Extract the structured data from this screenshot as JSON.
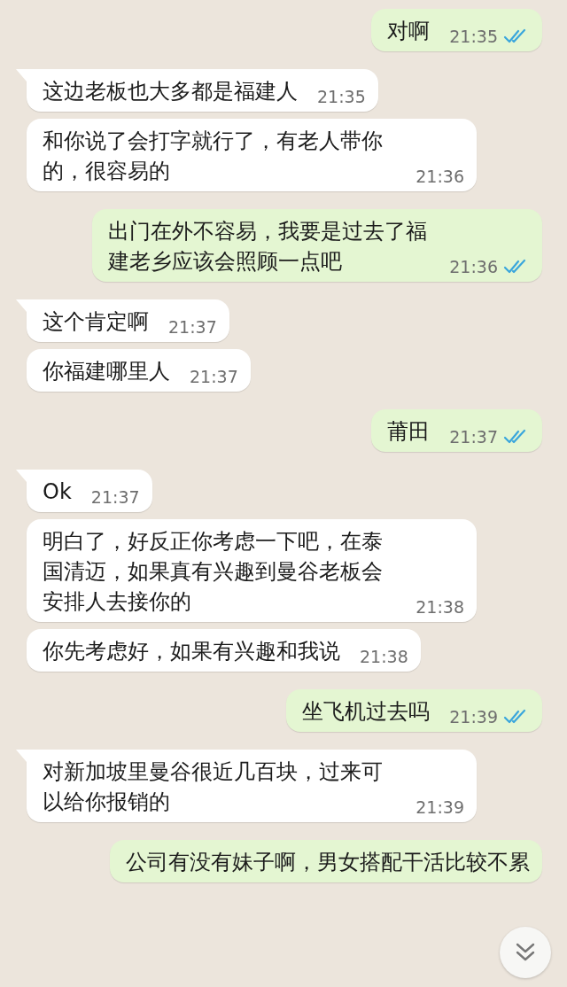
{
  "messages": [
    {
      "kind": "outgoing",
      "text": "对啊",
      "time": "21:35",
      "read": true
    },
    {
      "kind": "incoming",
      "text": "这边老板也大多都是福建人",
      "time": "21:35"
    },
    {
      "kind": "incoming",
      "text": "和你说了会打字就行了，有老人带你的，很容易的",
      "time": "21:36"
    },
    {
      "kind": "outgoing",
      "text": "出门在外不容易，我要是过去了福建老乡应该会照顾一点吧",
      "time": "21:36",
      "read": true
    },
    {
      "kind": "incoming",
      "text": "这个肯定啊",
      "time": "21:37"
    },
    {
      "kind": "incoming",
      "text": "你福建哪里人",
      "time": "21:37"
    },
    {
      "kind": "outgoing",
      "text": "莆田",
      "time": "21:37",
      "read": true
    },
    {
      "kind": "incoming",
      "text": "Ok",
      "time": "21:37"
    },
    {
      "kind": "incoming",
      "text": "明白了，好反正你考虑一下吧，在泰国清迈，如果真有兴趣到曼谷老板会安排人去接你的",
      "time": "21:38"
    },
    {
      "kind": "incoming",
      "text": "你先考虑好，如果有兴趣和我说",
      "time": "21:38"
    },
    {
      "kind": "outgoing",
      "text": "坐飞机过去吗",
      "time": "21:39",
      "read": true
    },
    {
      "kind": "incoming",
      "text": "对新加坡里曼谷很近几百块，过来可以给你报销的",
      "time": "21:39"
    },
    {
      "kind": "outgoing",
      "text": "公司有没有妹子啊，男女搭配干活比较不累"
    }
  ]
}
